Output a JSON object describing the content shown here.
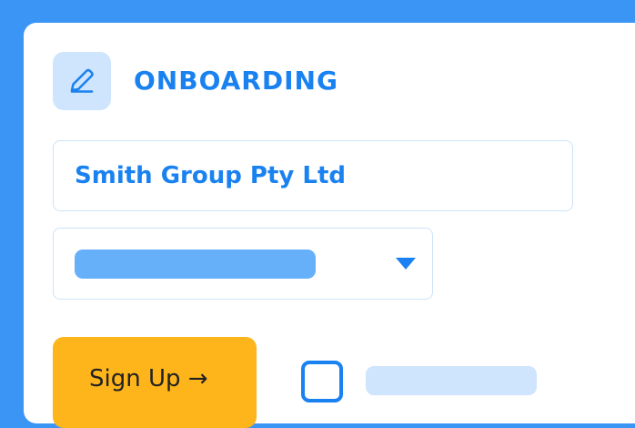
{
  "header": {
    "icon": "pencil-icon",
    "title": "ONBOARDING"
  },
  "form": {
    "company_field": {
      "value": "Smith Group Pty Ltd"
    },
    "dropdown": {
      "icon": "chevron-down-icon"
    },
    "signup_button": {
      "label": "Sign Up →"
    }
  },
  "colors": {
    "background": "#3b95f5",
    "card": "#ffffff",
    "accent": "#1a82f0",
    "icon_tile": "#cfe5fd",
    "field_border": "#cde3f8",
    "placeholder_bar": "#66aff9",
    "button": "#fdb51b"
  }
}
